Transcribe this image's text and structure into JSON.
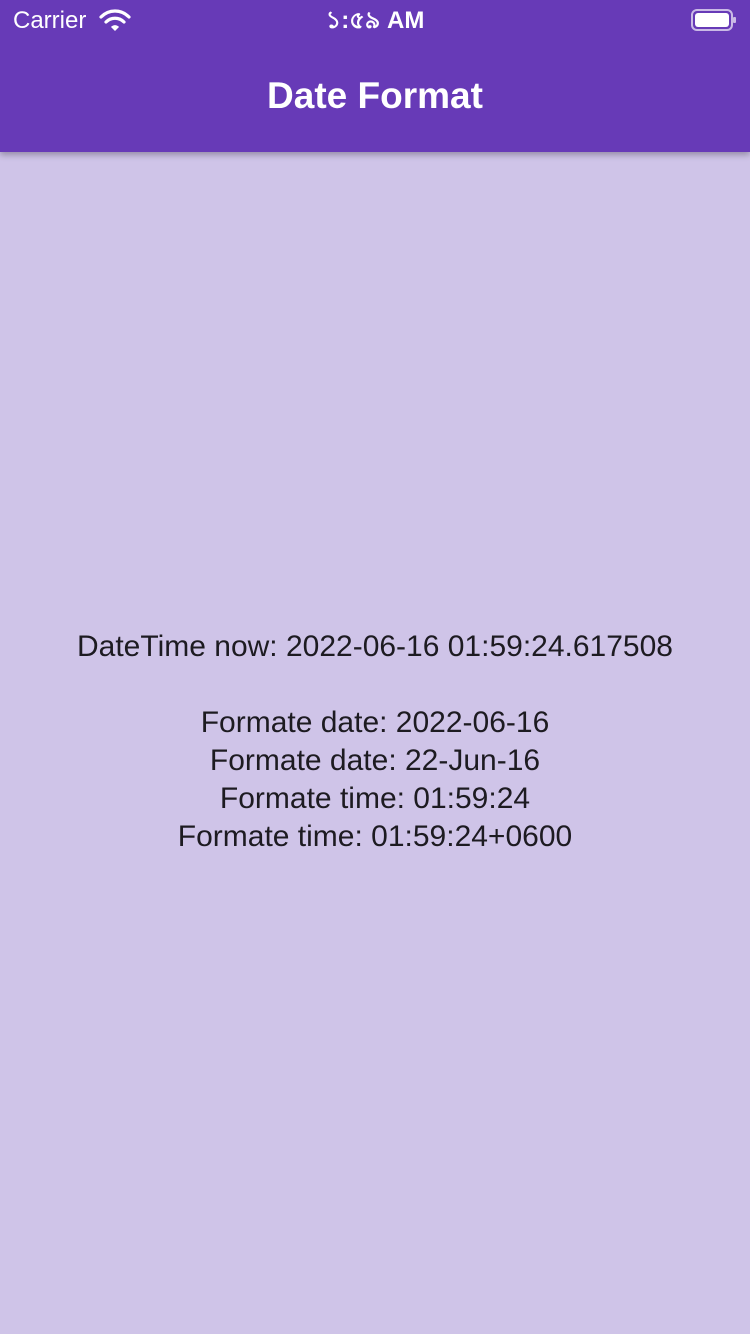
{
  "status_bar": {
    "carrier": "Carrier",
    "time": "১:৫৯ AM",
    "icons": [
      "wifi-icon",
      "battery-icon"
    ]
  },
  "app_bar": {
    "title": "Date Format"
  },
  "content": {
    "datetime_now": "DateTime now: 2022-06-16 01:59:24.617508",
    "lines": [
      "Formate date: 2022-06-16",
      "Formate date: 22-Jun-16",
      "Formate time: 01:59:24",
      "Formate time: 01:59:24+0600"
    ]
  },
  "colors": {
    "app_bar": "#673ab7",
    "background": "#cfc4e8",
    "text": "#1d1b21",
    "status_text": "#ffffff"
  }
}
